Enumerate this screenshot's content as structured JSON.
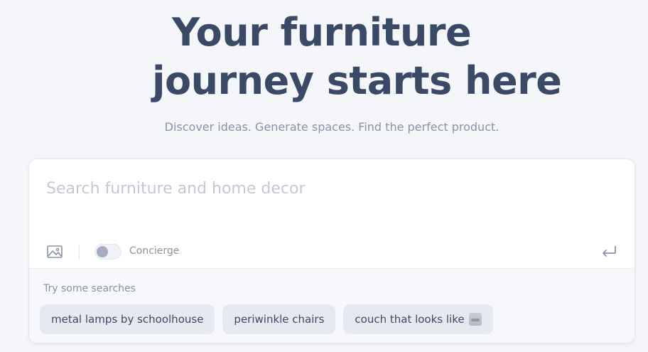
{
  "hero": {
    "title_line1": "Your furniture",
    "title_line2": "journey starts here",
    "subtitle": "Discover ideas. Generate spaces. Find the perfect product."
  },
  "search": {
    "placeholder": "Search furniture and home decor",
    "value": "",
    "image_icon": "image-icon",
    "submit_icon": "enter-arrow-icon",
    "concierge": {
      "label": "Concierge",
      "enabled": false
    }
  },
  "suggestions": {
    "title": "Try some searches",
    "chips": [
      {
        "label": "metal lamps by schoolhouse"
      },
      {
        "label": "periwinkle chairs"
      },
      {
        "label": "couch that looks like",
        "thumbnail": "couch-thumbnail"
      }
    ]
  },
  "colors": {
    "background": "#f5f6fa",
    "heading": "#3a4a66",
    "muted": "#8a93a6",
    "chip_bg": "#e6e9f1"
  }
}
